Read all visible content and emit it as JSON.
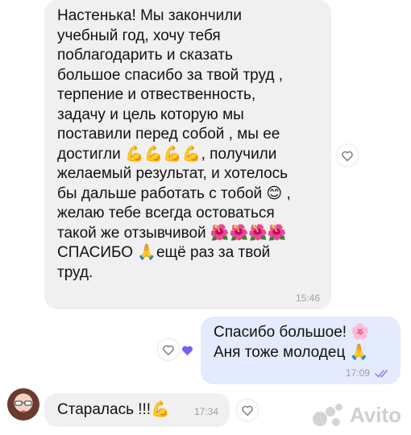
{
  "messages": [
    {
      "text": "Настенька! Мы закончили\nучебный год, хочу тебя\nпоблагодарить и сказать\nбольшое спасибо за твой труд ,\nтерпение и отвественность,\nзадачу и цель которую мы\nпоставили перед собой , мы ее\nдостигли 💪💪💪💪, получили\nжелаемый результат, и хотелось\nбы дальше работать с тобой 😊 ,\nжелаю тебе всегда остоваться\nтакой же отзывчивой 🌺🌺🌺🌺\nСПАСИБО 🙏ещё раз за твой\nтруд.",
      "time": "15:46"
    },
    {
      "text": "Спасибо большое! 🌸\nАня тоже молодец 🙏",
      "time": "17:09"
    },
    {
      "text": "Старалась !!!💪",
      "time": "17:34"
    }
  ],
  "icons": {
    "heart": "heart-outline-icon",
    "reaction": "purple-heart-icon",
    "read": "double-check-icon"
  },
  "watermark": {
    "text": "Avito"
  },
  "colors": {
    "incoming_bubble": "#f0f0f0",
    "outgoing_bubble": "#e3ebfd",
    "check": "#8e7cf0",
    "reaction": "#7b5cf5"
  }
}
